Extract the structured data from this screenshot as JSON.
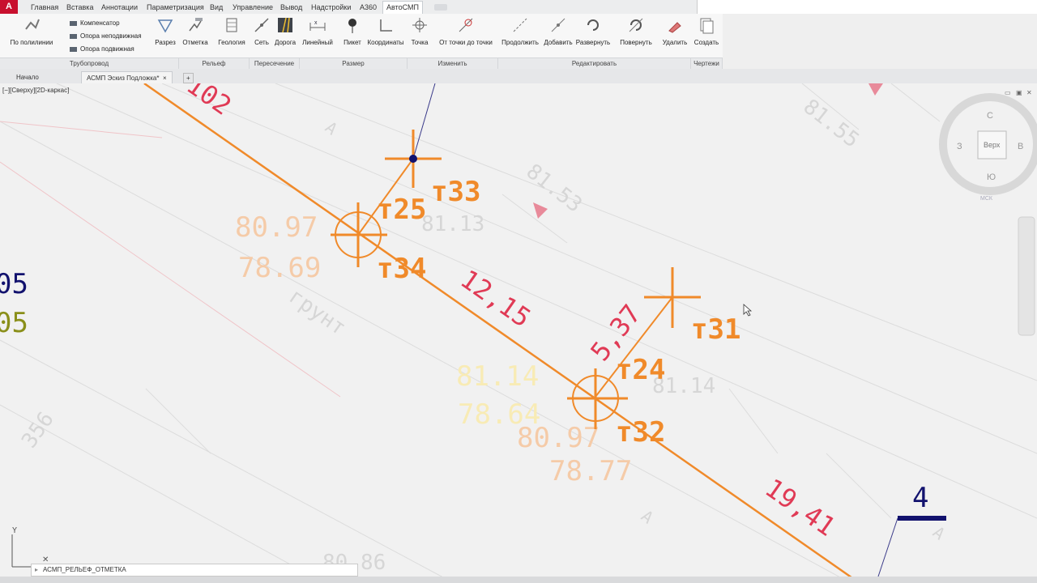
{
  "app": {
    "logo": "A"
  },
  "ribbon_tabs": [
    "Главная",
    "Вставка",
    "Аннотации",
    "Параметризация",
    "Вид",
    "Управление",
    "Вывод",
    "Надстройки",
    "А360",
    "АвтоСМП"
  ],
  "active_ribbon_tab": "АвтоСМП",
  "ribbon": {
    "truboprovod": {
      "po_polilinii": "По полилинии",
      "kompensator": "Компенсатор",
      "opora_nepodv": "Опора неподвижная",
      "opora_podv": "Опора подвижная",
      "razrez": "Разрез"
    },
    "relef": {
      "otmetka": "Отметка",
      "geologiya": "Геология"
    },
    "peresechenie": {
      "set": "Сеть",
      "doroga": "Дорога"
    },
    "razmer": {
      "lineyny": "Линейный",
      "piket": "Пикет",
      "koordinaty": "Координаты"
    },
    "izmenit": {
      "tochka": "Точка",
      "ot_tochki": "От точки до точки"
    },
    "redaktirovat": {
      "prodolzhit": "Продолжить",
      "dobavit": "Добавить",
      "razvernut": "Развернуть",
      "povernut": "Повернуть",
      "udalit": "Удалить"
    },
    "chertezhi": {
      "sozdat": "Создать"
    },
    "panels": [
      "Трубопровод",
      "Рельеф",
      "Пересечение",
      "Размер",
      "Изменить",
      "Редактировать",
      "Чертежи"
    ]
  },
  "doc_tabs": {
    "start": "Начало",
    "active": "АСМП Эскиз Подложка*",
    "close": "×",
    "add": "+"
  },
  "viewport": {
    "label": "[−][Сверху][2D-каркас]"
  },
  "viewcube": {
    "top": "Верх",
    "n": "С",
    "s": "Ю",
    "w": "З",
    "e": "В",
    "wcs": "МСК"
  },
  "drawing": {
    "lbl_102": "102",
    "lbl_m33": "т33",
    "lbl_m25": "т25",
    "lbl_m34": "т34",
    "lbl_m31": "т31",
    "lbl_m24": "т24",
    "lbl_m32": "т32",
    "dim_1215": "12,15",
    "dim_537": "5,37",
    "dim_1941": "19,41",
    "elev_8097a": "80.97",
    "elev_7869": "78.69",
    "elev_8097b": "80.97",
    "elev_7877": "78.77",
    "elev_8114y": "81.14",
    "elev_7864": "78.64",
    "gray_8155": "81.55",
    "gray_8153": "81.53",
    "gray_8113": "81.13",
    "gray_8114": "81.14",
    "gray_8086": "80.86",
    "gray_grunt": "грунт",
    "gray_356": "356",
    "gray_A1": "А",
    "gray_A2": "А",
    "gray_A3": "А",
    "left_05a": "05",
    "left_05b": "05",
    "lbl_4": "4",
    "axis_y": "Y"
  },
  "command_line": "АСМП_РЕЛЬЕФ_ОТМЕТКА",
  "colors": {
    "pipe": "#f08a2a",
    "dim": "#e03a55",
    "navy": "#12126e",
    "olive": "#8a8f1a",
    "elev": "#f5c9a6",
    "ghost": "#d9d0b8"
  }
}
